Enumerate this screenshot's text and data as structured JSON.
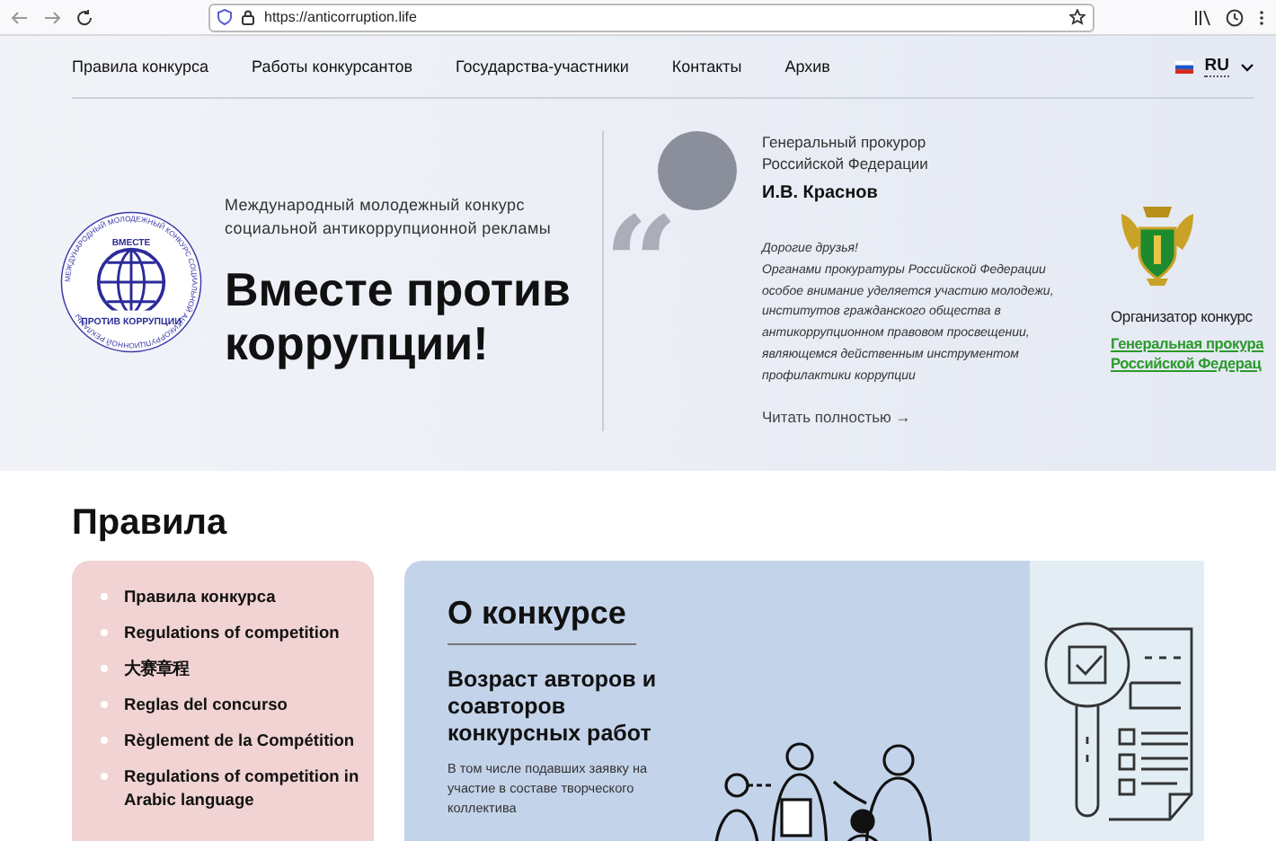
{
  "browser": {
    "url": "https://anticorruption.life"
  },
  "nav": {
    "items": [
      {
        "label": "Правила конкурса"
      },
      {
        "label": "Работы конкурсантов"
      },
      {
        "label": "Государства-участники"
      },
      {
        "label": "Контакты"
      },
      {
        "label": "Архив"
      }
    ],
    "language": "RU"
  },
  "hero": {
    "logo": {
      "top": "ВМЕСТЕ",
      "bottom": "ПРОТИВ КОРРУПЦИИ",
      "ring": "МЕЖДУНАРОДНЫЙ МОЛОДЕЖНЫЙ КОНКУРС СОЦИАЛЬНОЙ АНТИКОРРУПЦИОННОЙ РЕКЛАМЫ"
    },
    "subtitle": "Международный молодежный конкурс социальной антикоррупционной рекламы",
    "title": "Вместе против коррупции!",
    "person_role": "Генеральный прокурор Российской Федерации",
    "person_name": "И.В. Краснов",
    "quote_mark": "“",
    "quote": [
      "Дорогие друзья!",
      "Органами прокуратуры Российской Федерации особое внимание уделяется участию молодежи, институтов гражданского общества в антикоррупционном правовом просвещении, являющемся действенным инструментом профилактики коррупции"
    ],
    "read_more": "Читать полностью →",
    "organizer_label": "Организатор конкурс",
    "organizer_links": [
      "Генеральная прокура",
      "Российской Федерац"
    ]
  },
  "rules": {
    "heading": "Правила",
    "documents": [
      {
        "label": "Правила конкурса"
      },
      {
        "label": "Regulations of competition"
      },
      {
        "label": "大赛章程"
      },
      {
        "label": "Reglas del concurso"
      },
      {
        "label": "Règlement de la Compétition"
      },
      {
        "label": "Regulations of competition in Arabic language"
      }
    ],
    "about": {
      "heading": "О конкурсе",
      "subheading": "Возраст авторов и соавторов конкурсных работ",
      "text": "В том числе подавших заявку на участие в составе творческого коллектива"
    }
  }
}
